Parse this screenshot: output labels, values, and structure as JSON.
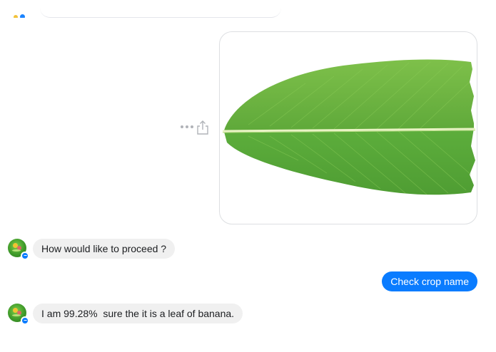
{
  "thread": {
    "accent_color": "#0a7cff",
    "incoming_bubble_color": "#f0f0f0",
    "bot_avatar_icon": "leaf-logo-icon",
    "messenger_badge_icon": "messenger-badge-icon"
  },
  "messages": {
    "proceed_prompt": "How would like to proceed ?",
    "user_reply": "Check crop name",
    "result": "I am 99.28%  sure the it is a leaf of banana."
  },
  "image_message": {
    "subject": "banana leaf photo",
    "actions": [
      "more-options-icon",
      "share-icon"
    ]
  }
}
